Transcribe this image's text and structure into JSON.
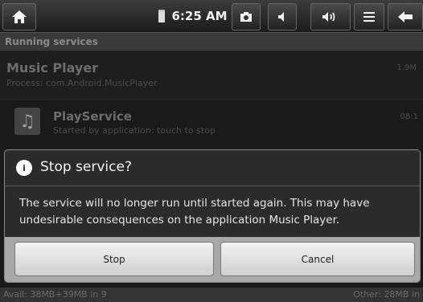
{
  "status_bar": {
    "time": "6:25 AM",
    "icons": [
      "home-icon",
      "battery-icon",
      "camera-icon",
      "volume-down-icon",
      "volume-up-icon",
      "menu-icon",
      "back-arrow-icon"
    ]
  },
  "background": {
    "section_header": "Running services",
    "app": {
      "name": "Music Player",
      "process": "Process: com.Android.MusicPlayer",
      "size": "1.9M"
    },
    "service": {
      "name": "PlayService",
      "status": "Started by application: touch to stop",
      "time": "08:1"
    },
    "footer": {
      "avail": "Avail: 38MB+39MB in 9",
      "other": "Other: 28MB in"
    }
  },
  "dialog": {
    "title": "Stop service?",
    "message": "The service will no longer run until started again. This may have undesirable consequences on the application Music Player.",
    "stop_label": "Stop",
    "cancel_label": "Cancel"
  }
}
